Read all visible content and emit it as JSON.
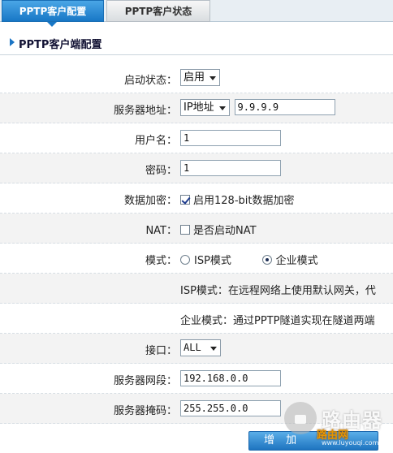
{
  "tabs": [
    {
      "label": "PPTP客户配置",
      "active": true
    },
    {
      "label": "PPTP客户状态",
      "active": false
    }
  ],
  "section_title": "PPTP客户端配置",
  "form": {
    "status": {
      "label": "启动状态：",
      "value": "启用"
    },
    "server": {
      "label": "服务器地址：",
      "type_value": "IP地址",
      "address": "9.9.9.9"
    },
    "username": {
      "label": "用户名：",
      "value": "1"
    },
    "password": {
      "label": "密码：",
      "value": "1"
    },
    "encryption": {
      "label": "数据加密：",
      "option": "启用128-bit数据加密",
      "checked": true
    },
    "nat": {
      "label": "NAT：",
      "option": "是否启动NAT",
      "checked": false
    },
    "mode": {
      "label": "模式：",
      "isp_option": "ISP模式",
      "enterprise_option": "企业模式",
      "selected": "企业模式"
    },
    "isp_desc": "ISP模式：在远程网络上使用默认网关，代",
    "enterprise_desc": "企业模式：通过PPTP隧道实现在隧道两端",
    "interface": {
      "label": "接口：",
      "value": "ALL"
    },
    "subnet": {
      "label": "服务器网段：",
      "value": "192.168.0.0"
    },
    "mask": {
      "label": "服务器掩码：",
      "value": "255.255.0.0"
    }
  },
  "add_button": "增 加",
  "watermark": {
    "text": "路由器",
    "sub": "路由网",
    "url": "www.luyouqi.com"
  },
  "colors": {
    "accent": "#1877c6",
    "row_alt": "#f3f3f3"
  }
}
